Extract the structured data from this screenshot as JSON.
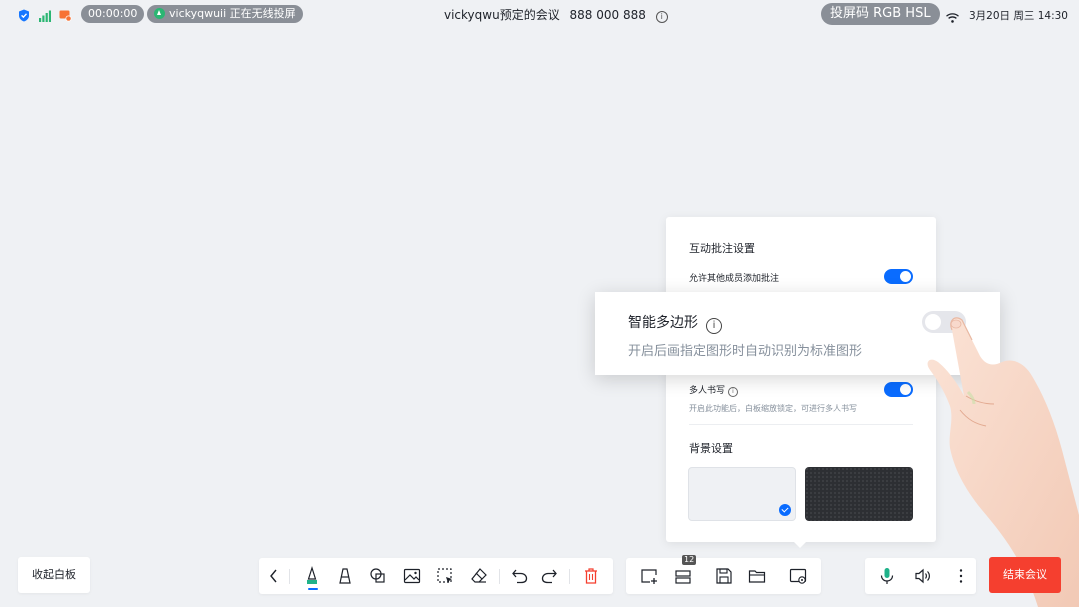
{
  "status_bar": {
    "timer": "00:00:00",
    "screen_share": "vickyqwuii 正在无线投屏",
    "meeting_title": "vickyqwu预定的会议",
    "meeting_id": "888 000 888",
    "cast_code": "投屏码 RGB HSL",
    "date_time": "3月20日 周三 14:30"
  },
  "settings_panel": {
    "annotation_section_title": "互动批注设置",
    "allow_annotation_label": "允许其他成员添加批注",
    "multi_write_label": "多人书写",
    "multi_write_desc": "开启此功能后，白板缩放锁定，可进行多人书写",
    "background_section_title": "背景设置"
  },
  "callout": {
    "title": "智能多边形",
    "description": "开启后画指定图形时自动识别为标准图形"
  },
  "bottom_bar": {
    "collapse_label": "收起白板",
    "page_badge": "12",
    "end_meeting_label": "结束会议"
  },
  "colors": {
    "accent": "#0a6cff",
    "danger": "#f53f2f",
    "background": "#eff1f4"
  },
  "icons": {
    "status": [
      "shield-icon",
      "signal-icon",
      "network-warning-icon",
      "wifi-icon",
      "info-icon"
    ],
    "toolbar": [
      "back-icon",
      "pen-icon",
      "highlighter-icon",
      "shape-icon",
      "image-icon",
      "select-icon",
      "eraser-icon",
      "undo-icon",
      "redo-icon",
      "delete-icon",
      "add-page-icon",
      "pages-icon",
      "save-icon",
      "open-folder-icon",
      "whiteboard-settings-icon",
      "microphone-icon",
      "speaker-icon",
      "more-icon"
    ]
  }
}
